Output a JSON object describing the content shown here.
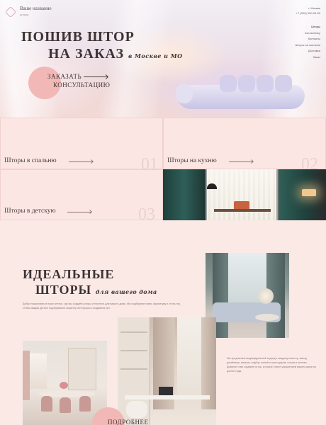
{
  "header": {
    "brand_name": "Ваше название",
    "brand_sub": "шторы",
    "city": "г. Москва",
    "phone": "+7 (000) 000-00-00"
  },
  "nav": [
    "Шторы",
    "Ателье/Шоу",
    "Контакты",
    "Шторы на спальню",
    "Доставка",
    "Заказ"
  ],
  "hero": {
    "title_line1": "ПОШИВ ШТОР",
    "title_line2": "НА ЗАКАЗ",
    "title_script": "в Москве и МО",
    "cta_line1": "ЗАКАЗАТЬ",
    "cta_line2": "КОНСУЛЬТАЦИЮ"
  },
  "categories": [
    {
      "label": "Шторы в спальню",
      "num": "01"
    },
    {
      "label": "Шторы на кухню",
      "num": "02"
    },
    {
      "label": "Шторы в детскую",
      "num": "03"
    }
  ],
  "ideal": {
    "title_line1": "ИДЕАЛЬНЫЕ",
    "title_line2": "ШТОРЫ",
    "title_script": "для вашего дома",
    "text": "Добро пожаловать в наше ателье, где мы создаём шторы и текстиль для вашего дома. Мы подбираем ткани, фурнитуру и стиль так, чтобы каждая деталь подчёркивала характер интерьера и создавала уют.",
    "right_text": "Мы предлагаем индивидуальный подход к каждому клиенту: выезд дизайнера, замеры, подбор тканей и аксессуаров, пошив и монтаж. Доверьте нам создание штор, которые станут украшением вашего дома на долгие годы.",
    "more_label": "ПОДРОБНЕЕ"
  }
}
